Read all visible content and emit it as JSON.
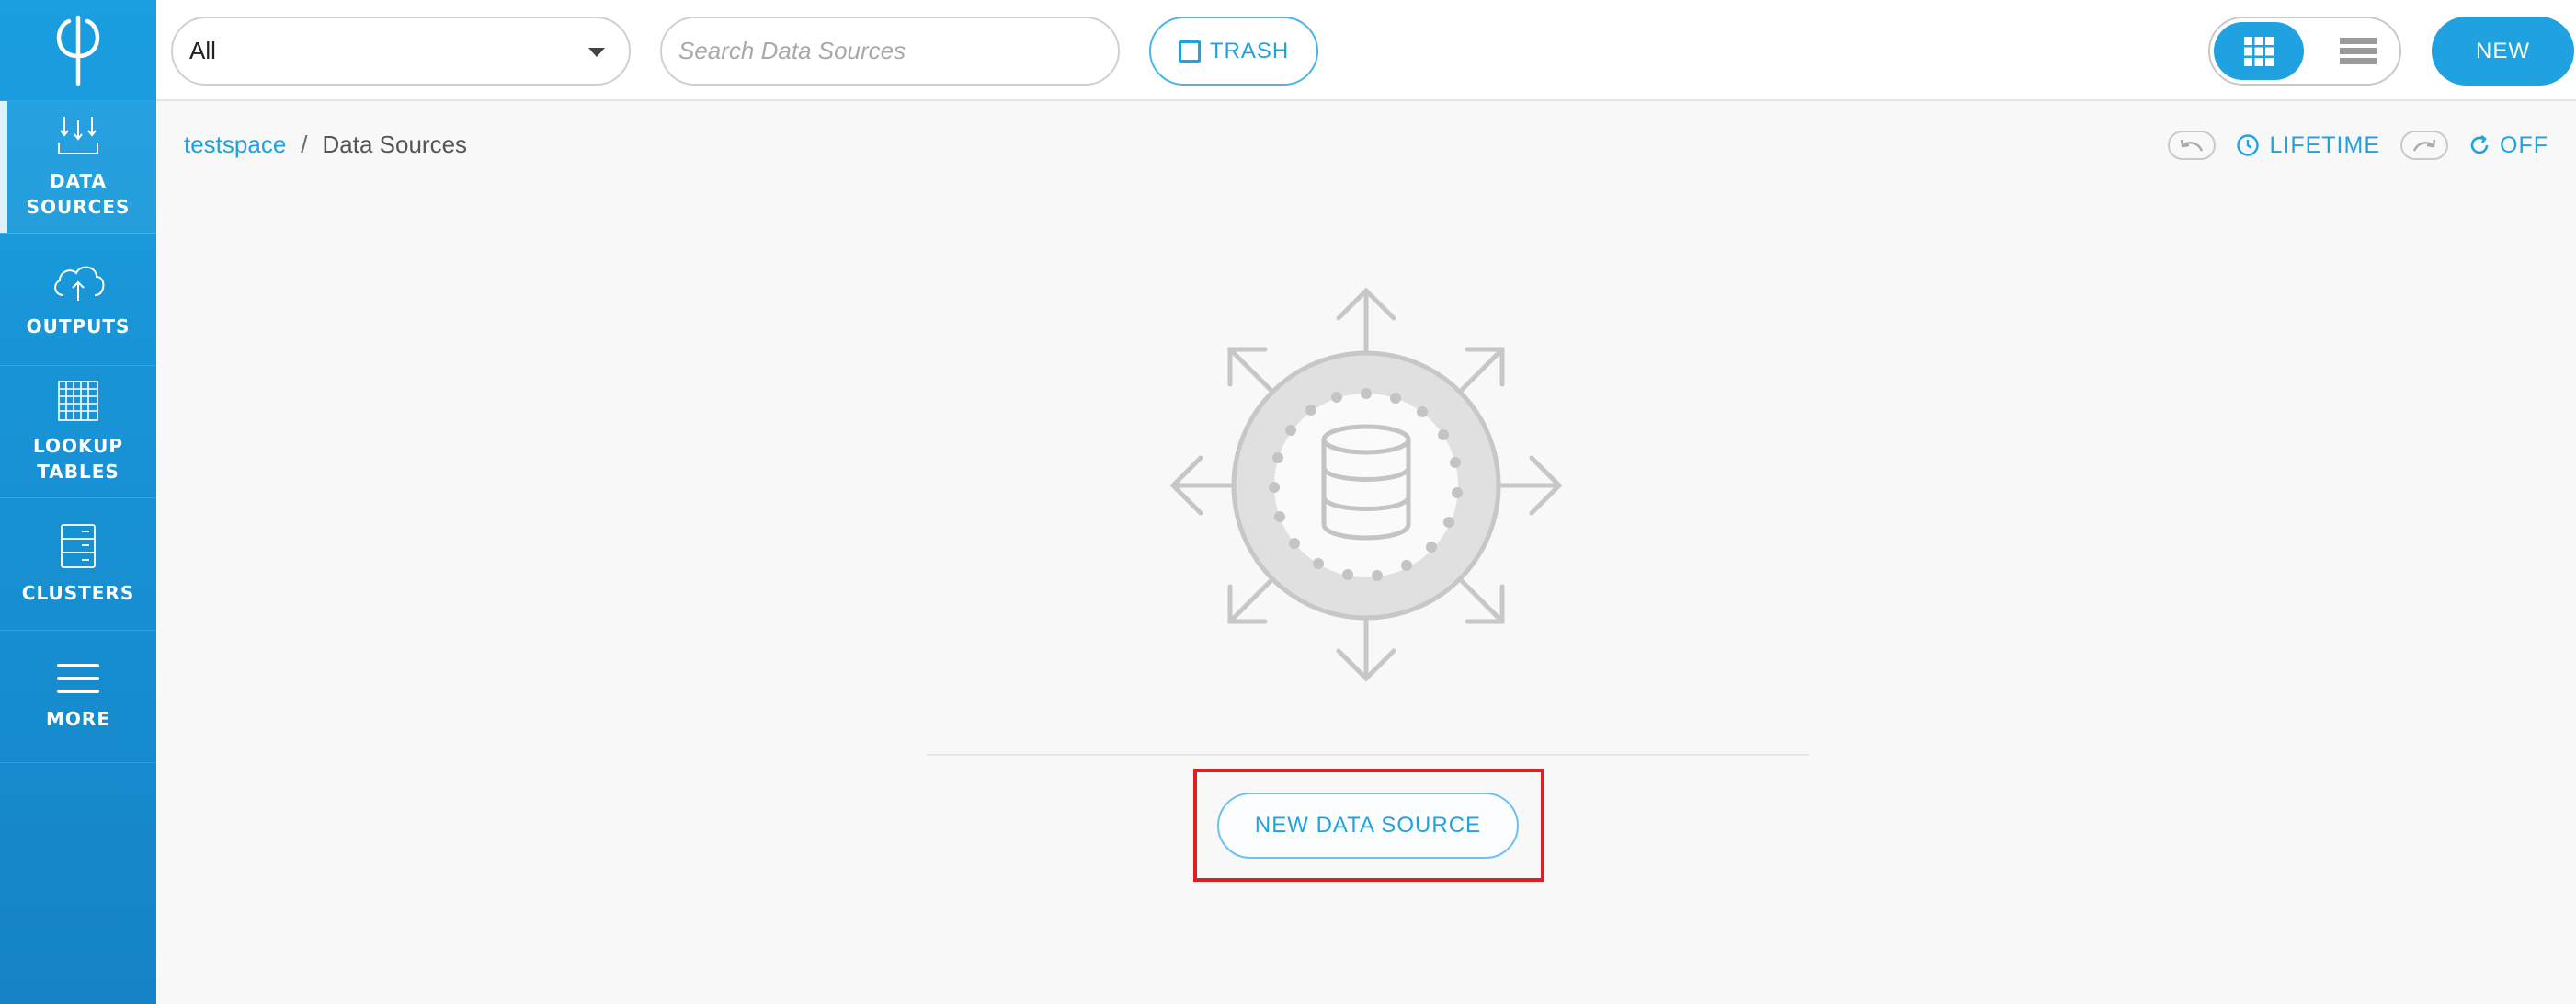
{
  "sidebar": {
    "items": [
      {
        "label": "DATA\nSOURCES",
        "icon": "data-sources-icon"
      },
      {
        "label": "OUTPUTS",
        "icon": "cloud-upload-icon"
      },
      {
        "label": "LOOKUP\nTABLES",
        "icon": "grid-table-icon"
      },
      {
        "label": "CLUSTERS",
        "icon": "server-rack-icon"
      },
      {
        "label": "MORE",
        "icon": "hamburger-menu-icon"
      }
    ]
  },
  "topbar": {
    "filter_value": "All",
    "search_placeholder": "Search Data Sources",
    "trash_label": "TRASH",
    "new_label": "NEW"
  },
  "breadcrumb": {
    "workspace": "testspace",
    "separator": "/",
    "current": "Data Sources"
  },
  "history": {
    "lifetime_label": "LIFETIME",
    "refresh_label": "OFF"
  },
  "empty_state": {
    "button_label": "NEW DATA SOURCE"
  },
  "colors": {
    "accent": "#1fa2df",
    "sidebar": "#1a9ee0",
    "highlight": "#e02020"
  }
}
